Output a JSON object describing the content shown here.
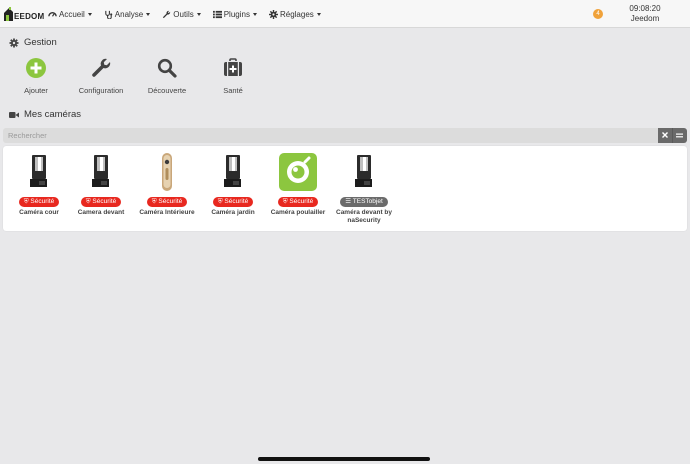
{
  "app": {
    "logo_text": "EEDOM"
  },
  "nav": {
    "items": [
      {
        "label": "Accueil",
        "icon": "dashboard-icon"
      },
      {
        "label": "Analyse",
        "icon": "stethoscope-icon"
      },
      {
        "label": "Outils",
        "icon": "wrench-icon"
      },
      {
        "label": "Plugins",
        "icon": "list-icon"
      },
      {
        "label": "Réglages",
        "icon": "gear-icon"
      }
    ],
    "notification_count": "4",
    "time": "09:08:20",
    "user": "Jeedom"
  },
  "gestion": {
    "title": "Gestion",
    "items": [
      {
        "label": "Ajouter",
        "icon": "plus-circle-icon"
      },
      {
        "label": "Configuration",
        "icon": "wrench-icon"
      },
      {
        "label": "Découverte",
        "icon": "search-icon"
      },
      {
        "label": "Santé",
        "icon": "medkit-icon"
      }
    ]
  },
  "cameras_section": {
    "title": "Mes caméras",
    "search_placeholder": "Rechercher"
  },
  "cameras": [
    {
      "name": "Caméra cour",
      "badge": "Sécurité",
      "badge_color": "#e8281f",
      "type": "outdoor"
    },
    {
      "name": "Camera devant",
      "badge": "Sécurité",
      "badge_color": "#e8281f",
      "type": "outdoor"
    },
    {
      "name": "Caméra Intérieure",
      "badge": "Sécurité",
      "badge_color": "#e8281f",
      "type": "indoor"
    },
    {
      "name": "Caméra jardin",
      "badge": "Sécurité",
      "badge_color": "#e8281f",
      "type": "outdoor"
    },
    {
      "name": "Caméra poulailler",
      "badge": "Sécurité",
      "badge_color": "#e8281f",
      "type": "generic"
    },
    {
      "name": "Caméra devant by naSecurity",
      "badge": "TESTobjet",
      "badge_color": "#6b6b6b",
      "type": "outdoor"
    }
  ],
  "colors": {
    "accent_green": "#8cc63f",
    "badge_red": "#e8281f",
    "notif_orange": "#f0a23a"
  }
}
